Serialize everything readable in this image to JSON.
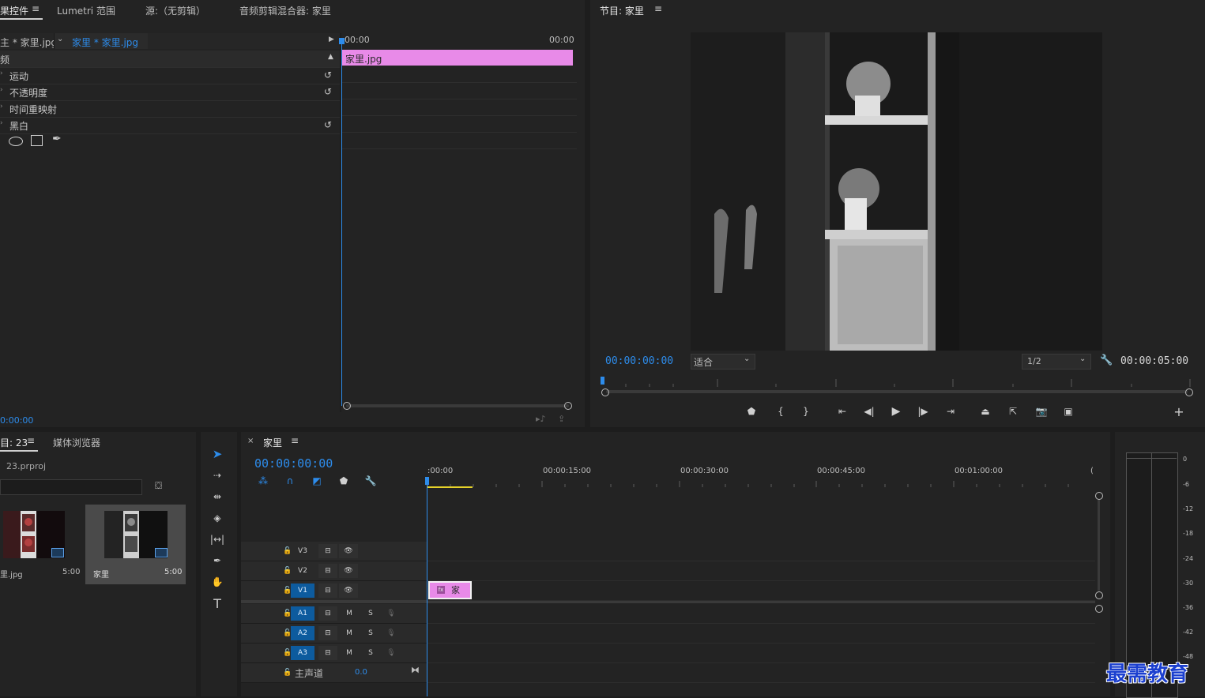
{
  "effect_controls": {
    "tab_label": "果控件",
    "tabs": [
      "Lumetri 范围",
      "源:（无剪辑）",
      "音频剪辑混合器: 家里"
    ],
    "master_clip": "主 * 家里.jpg",
    "sequence_clip": "家里 * 家里.jpg",
    "time_start": "00:00",
    "time_end": "00:00",
    "clip_bar_label": "家里.jpg",
    "section_label": "频",
    "effects": [
      {
        "label": "运动",
        "has_reset": true
      },
      {
        "label": "不透明度",
        "has_reset": true
      },
      {
        "label": "时间重映射",
        "has_reset": false
      },
      {
        "label": "黑白",
        "has_reset": true
      }
    ],
    "current_time": "0:00:00"
  },
  "program_monitor": {
    "title": "节目: 家里",
    "timecode": "00:00:00:00",
    "fit_label": "适合",
    "resolution": "1/2",
    "duration": "00:00:05:00",
    "preview_image": "black-and-white interior shelf with flowers"
  },
  "project": {
    "tab_label": "目: 23",
    "media_browser": "媒体浏览器",
    "file": "23.prproj",
    "items": [
      {
        "name": "里.jpg",
        "duration": "5:00",
        "thumb": "color shelf"
      },
      {
        "name": "家里",
        "duration": "5:00",
        "thumb": "bw shelf"
      }
    ]
  },
  "timeline": {
    "sequence_name": "家里",
    "timecode": "00:00:00:00",
    "ruler_labels": [
      ":00:00",
      "00:00:15:00",
      "00:00:30:00",
      "00:00:45:00",
      "00:01:00:00",
      "("
    ],
    "video_tracks": [
      "V3",
      "V2",
      "V1"
    ],
    "audio_tracks": [
      "A1",
      "A2",
      "A3"
    ],
    "master_label": "主声道",
    "master_value": "0.0",
    "clip_label": "家",
    "audio_m": "M",
    "audio_s": "S"
  },
  "meter": {
    "scale": [
      "0",
      "-6",
      "-12",
      "-18",
      "-24",
      "-30",
      "-36",
      "-42",
      "-48"
    ]
  },
  "watermark": "最需教育",
  "colors": {
    "accent_blue": "#2d8ceb",
    "clip_pink": "#e88ae8",
    "panel_bg": "#232323",
    "track_on": "#0d5b9e"
  }
}
